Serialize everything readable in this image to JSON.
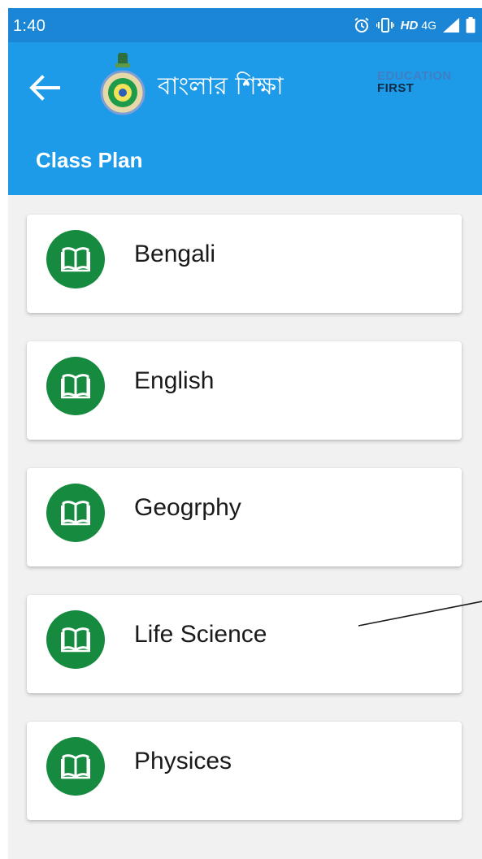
{
  "status_bar": {
    "time": "1:40",
    "hd_label": "HD",
    "network_label": "4G"
  },
  "app_bar": {
    "app_title": "বাংলার শিক্ষা",
    "brand_line1": "EDUCATION",
    "brand_line2": "FIRST",
    "page_title": "Class Plan"
  },
  "subjects": [
    {
      "name": "Bengali"
    },
    {
      "name": "English"
    },
    {
      "name": "Geogrphy"
    },
    {
      "name": "Life Science"
    },
    {
      "name": "Physices"
    }
  ],
  "colors": {
    "status_bar": "#1a86d5",
    "app_bar": "#1e9be8",
    "book_badge": "#168a3f",
    "page_background": "#f1f1f1"
  }
}
